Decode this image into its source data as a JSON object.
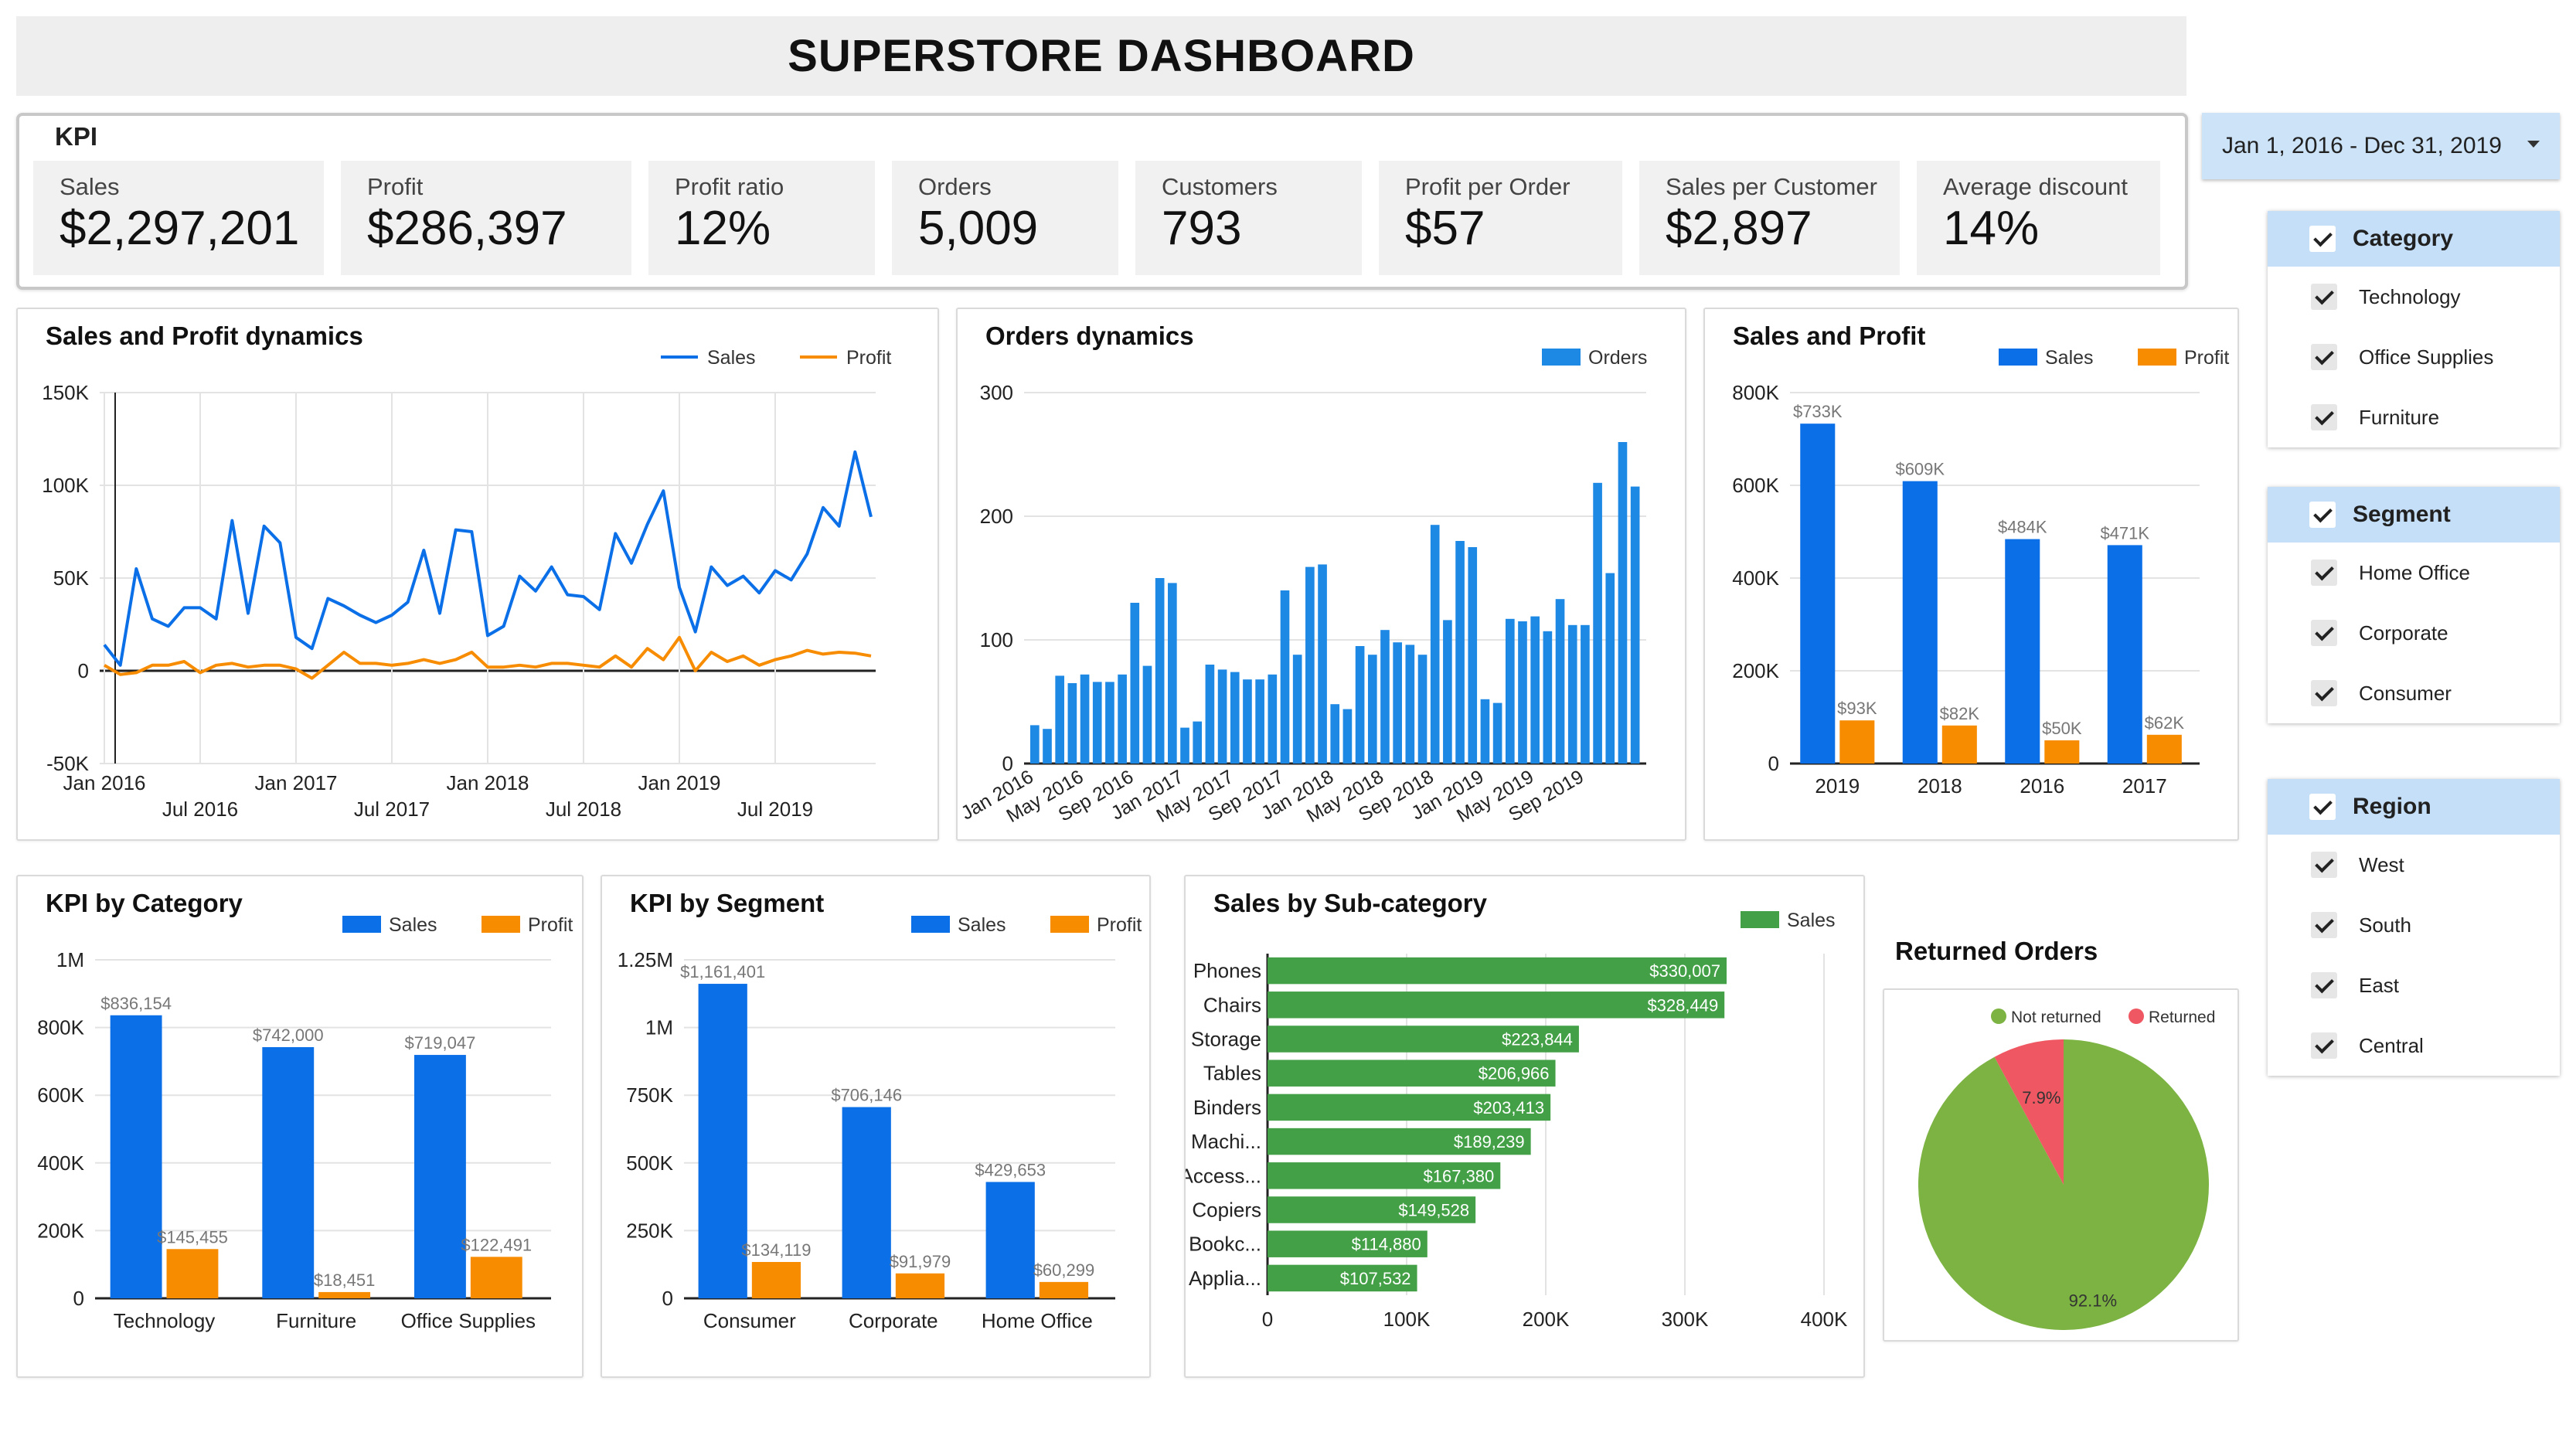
{
  "dashboard": {
    "title": "SUPERSTORE DASHBOARD"
  },
  "kpi": {
    "heading": "KPI",
    "tiles": [
      {
        "label": "Sales",
        "value": "$2,297,201"
      },
      {
        "label": "Profit",
        "value": "$286,397"
      },
      {
        "label": "Profit ratio",
        "value": "12%"
      },
      {
        "label": "Orders",
        "value": "5,009"
      },
      {
        "label": "Customers",
        "value": "793"
      },
      {
        "label": "Profit per Order",
        "value": "$57"
      },
      {
        "label": "Sales per Customer",
        "value": "$2,897"
      },
      {
        "label": "Average discount",
        "value": "14%"
      }
    ]
  },
  "date_range": {
    "label": "Jan 1, 2016 - Dec 31, 2019"
  },
  "filters": [
    {
      "title": "Category",
      "items": [
        "Technology",
        "Office Supplies",
        "Furniture"
      ]
    },
    {
      "title": "Segment",
      "items": [
        "Home Office",
        "Corporate",
        "Consumer"
      ]
    },
    {
      "title": "Region",
      "items": [
        "West",
        "South",
        "East",
        "Central"
      ]
    }
  ],
  "colors": {
    "sales": "#0b6fe8",
    "profit": "#f78c00",
    "orders": "#1e88e5",
    "subcat": "#43a047",
    "not_returned": "#7cb342",
    "returned": "#ef5862"
  },
  "chart_data": [
    {
      "id": "sales_profit_dynamics",
      "title": "Sales and  Profit dynamics",
      "type": "line",
      "y_ticks": [
        "150K",
        "100K",
        "50K",
        "0",
        "-50K"
      ],
      "ylim": [
        -50000,
        150000
      ],
      "x_ticks_top": [
        "Jan 2016",
        "Jan 2017",
        "Jan 2018",
        "Jan 2019"
      ],
      "x_ticks_bottom": [
        "Jul 2016",
        "Jul 2017",
        "Jul 2018",
        "Jul 2019"
      ],
      "series": [
        {
          "name": "Sales",
          "values": [
            14000,
            3000,
            55000,
            28000,
            24000,
            34000,
            34000,
            28000,
            81000,
            31000,
            78000,
            69000,
            18000,
            12000,
            39000,
            35000,
            30000,
            26000,
            30000,
            37000,
            65000,
            31000,
            76000,
            75000,
            19000,
            24000,
            51000,
            43000,
            56000,
            41000,
            40000,
            33000,
            74000,
            58000,
            79000,
            97000,
            45000,
            21000,
            56000,
            46000,
            51000,
            42000,
            54000,
            49000,
            63000,
            88000,
            78000,
            118000,
            83000
          ]
        },
        {
          "name": "Profit",
          "values": [
            3000,
            -2000,
            -1000,
            3000,
            3000,
            5000,
            -1000,
            3000,
            4000,
            2000,
            3000,
            3000,
            1000,
            -4000,
            3000,
            10000,
            4000,
            4000,
            3000,
            4000,
            6000,
            4000,
            6000,
            10000,
            2000,
            2000,
            3000,
            2000,
            4000,
            4000,
            3000,
            2000,
            8000,
            2000,
            12000,
            6000,
            18000,
            0,
            10000,
            5000,
            8000,
            3000,
            6000,
            8000,
            11000,
            9000,
            10000,
            9500,
            8000
          ]
        }
      ]
    },
    {
      "id": "orders_dynamics",
      "title": "Orders dynamics",
      "type": "bar",
      "y_ticks": [
        "300",
        "200",
        "100",
        "0"
      ],
      "ylim": [
        0,
        300
      ],
      "x_ticks": [
        "Jan 2016",
        "May 2016",
        "Sep 2016",
        "Jan 2017",
        "May 2017",
        "Sep 2017",
        "Jan 2018",
        "May 2018",
        "Sep 2018",
        "Jan 2019",
        "May 2019",
        "Sep 2019"
      ],
      "series": [
        {
          "name": "Orders",
          "values": [
            31,
            28,
            71,
            65,
            72,
            66,
            66,
            72,
            130,
            79,
            150,
            146,
            29,
            34,
            80,
            76,
            74,
            68,
            68,
            72,
            140,
            88,
            159,
            161,
            48,
            44,
            95,
            88,
            108,
            98,
            96,
            88,
            193,
            116,
            180,
            175,
            52,
            49,
            117,
            115,
            119,
            107,
            133,
            112,
            112,
            227,
            154,
            260,
            224
          ]
        }
      ]
    },
    {
      "id": "sales_profit_by_year",
      "title": "Sales and Profit",
      "type": "bar",
      "y_ticks": [
        "800K",
        "600K",
        "400K",
        "200K",
        "0"
      ],
      "ylim": [
        0,
        800000
      ],
      "categories": [
        "2019",
        "2018",
        "2016",
        "2017"
      ],
      "series": [
        {
          "name": "Sales",
          "values": [
            733000,
            609000,
            484000,
            471000
          ],
          "labels": [
            "$733K",
            "$609K",
            "$484K",
            "$471K"
          ]
        },
        {
          "name": "Profit",
          "values": [
            93000,
            82000,
            50000,
            62000
          ],
          "labels": [
            "$93K",
            "$82K",
            "$50K",
            "$62K"
          ]
        }
      ]
    },
    {
      "id": "kpi_by_category",
      "title": "KPI by Category",
      "type": "bar",
      "y_ticks": [
        "1M",
        "800K",
        "600K",
        "400K",
        "200K",
        "0"
      ],
      "ylim": [
        0,
        1000000
      ],
      "categories": [
        "Technology",
        "Furniture",
        "Office Supplies"
      ],
      "series": [
        {
          "name": "Sales",
          "values": [
            836154,
            742000,
            719047
          ],
          "labels": [
            "$836,154",
            "$742,000",
            "$719,047"
          ]
        },
        {
          "name": "Profit",
          "values": [
            145455,
            18451,
            122491
          ],
          "labels": [
            "$145,455",
            "$18,451",
            "$122,491"
          ]
        }
      ]
    },
    {
      "id": "kpi_by_segment",
      "title": "KPI by Segment",
      "type": "bar",
      "y_ticks": [
        "1.25M",
        "1M",
        "750K",
        "500K",
        "250K",
        "0"
      ],
      "ylim": [
        0,
        1250000
      ],
      "categories": [
        "Consumer",
        "Corporate",
        "Home Office"
      ],
      "series": [
        {
          "name": "Sales",
          "values": [
            1161401,
            706146,
            429653
          ],
          "labels": [
            "$1,161,401",
            "$706,146",
            "$429,653"
          ]
        },
        {
          "name": "Profit",
          "values": [
            134119,
            91979,
            60299
          ],
          "labels": [
            "$134,119",
            "$91,979",
            "$60,299"
          ]
        }
      ]
    },
    {
      "id": "sales_by_subcategory",
      "title": "Sales by Sub-category",
      "type": "bar",
      "orientation": "horizontal",
      "x_ticks": [
        "0",
        "100K",
        "200K",
        "300K",
        "400K"
      ],
      "xlim": [
        0,
        400000
      ],
      "categories": [
        "Phones",
        "Chairs",
        "Storage",
        "Tables",
        "Binders",
        "Machi...",
        "Access...",
        "Copiers",
        "Bookc...",
        "Applia..."
      ],
      "series": [
        {
          "name": "Sales",
          "values": [
            330007,
            328449,
            223844,
            206966,
            203413,
            189239,
            167380,
            149528,
            114880,
            107532
          ],
          "labels": [
            "$330,007",
            "$328,449",
            "$223,844",
            "$206,966",
            "$203,413",
            "$189,239",
            "$167,380",
            "$149,528",
            "$114,880",
            "$107,532"
          ]
        }
      ]
    },
    {
      "id": "returned_orders",
      "title": "Returned Orders",
      "type": "pie",
      "categories": [
        "Not returned",
        "Returned"
      ],
      "values": [
        92.1,
        7.9
      ],
      "labels": [
        "92.1%",
        "7.9%"
      ]
    }
  ]
}
